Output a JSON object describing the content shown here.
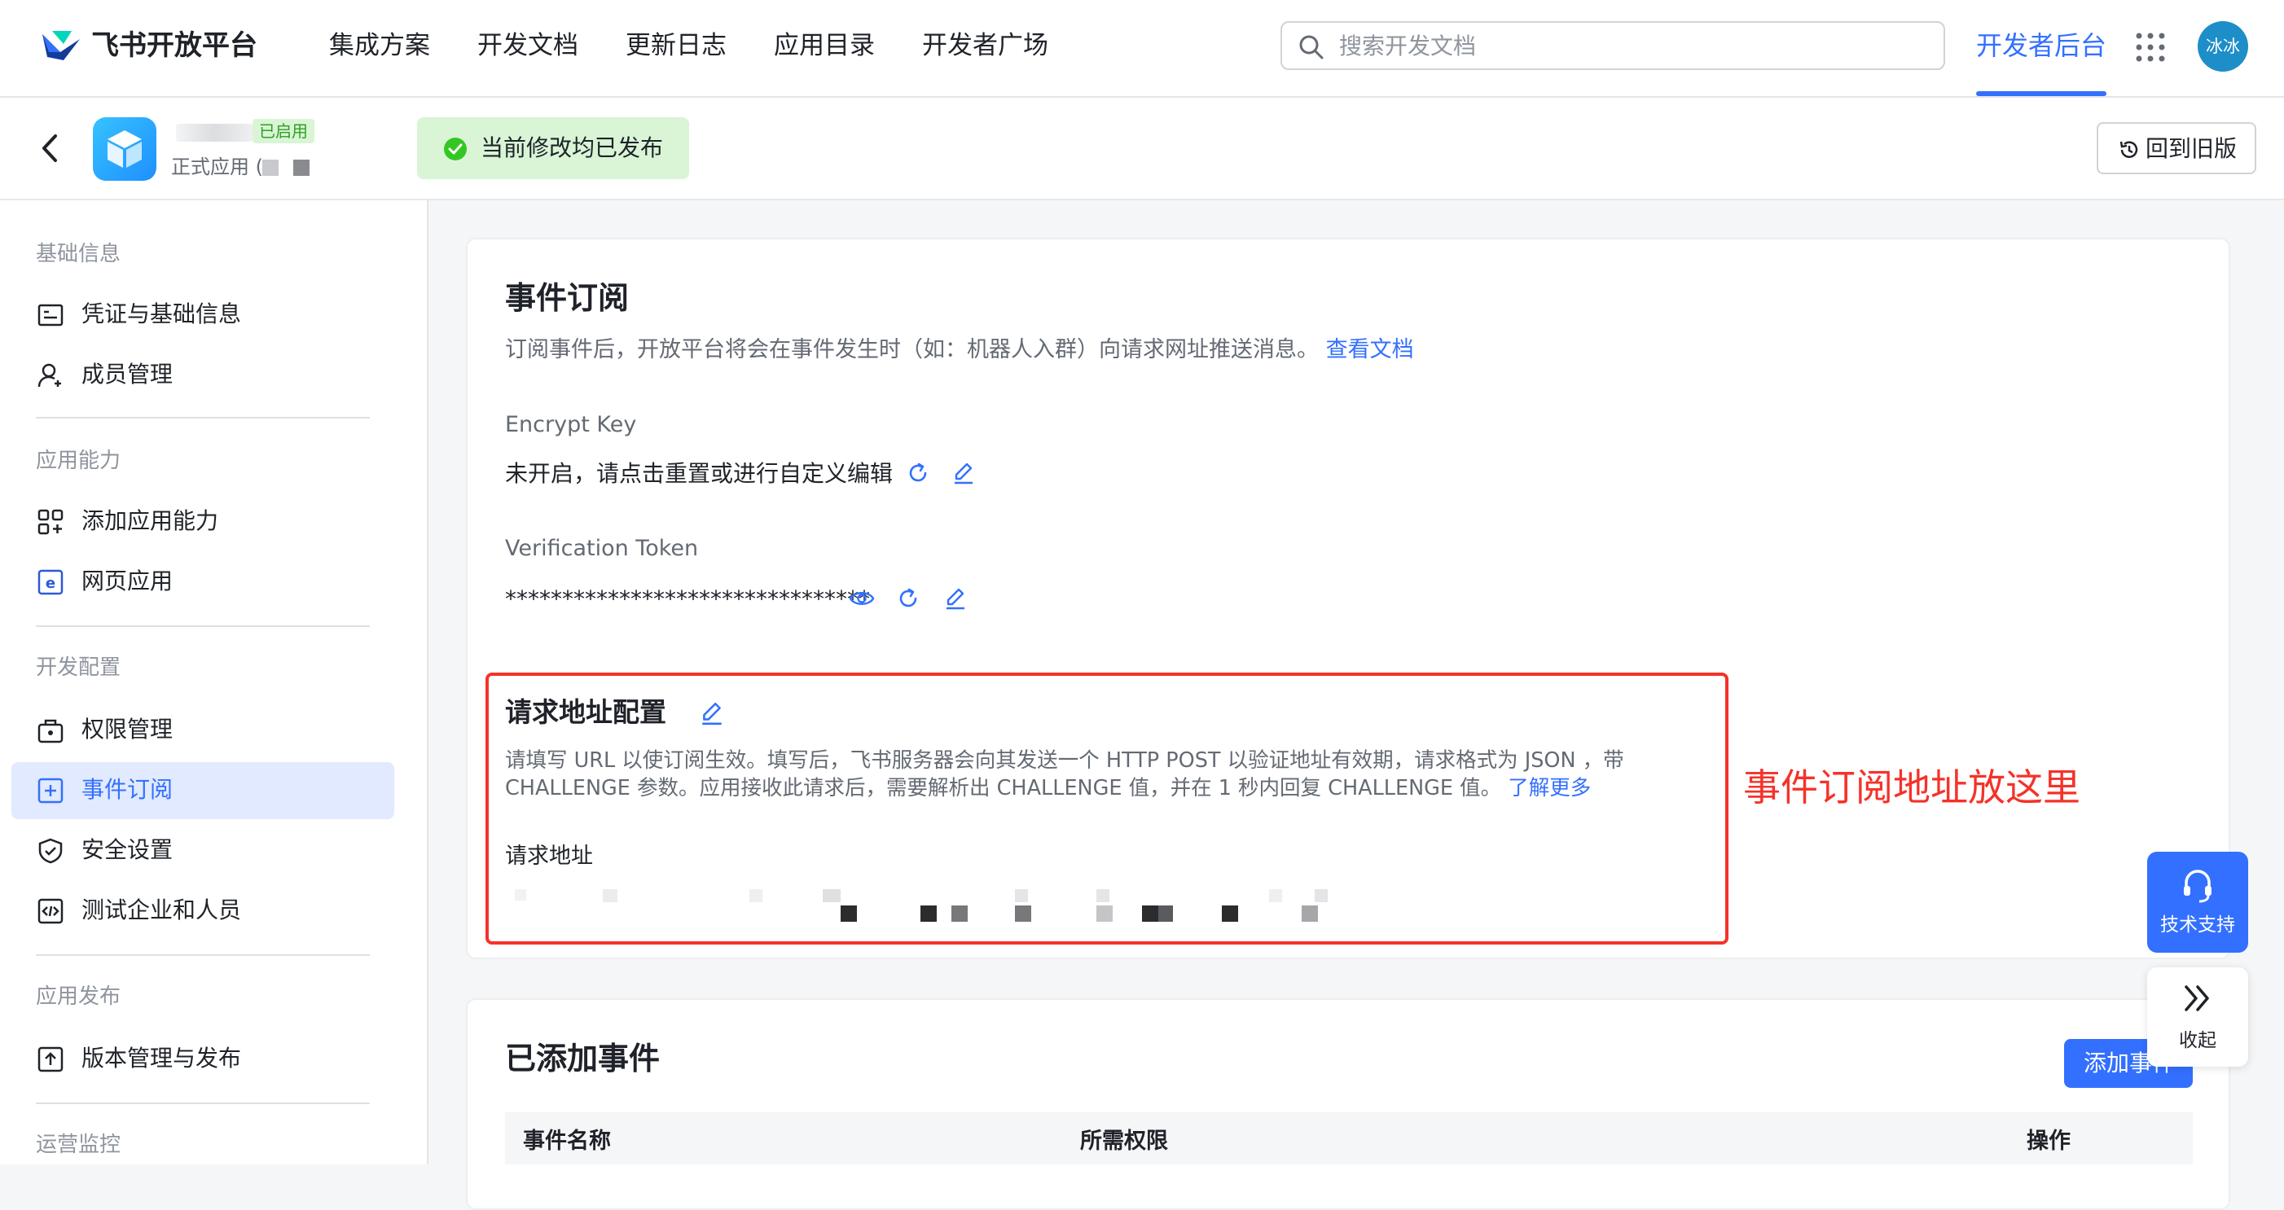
{
  "brand": {
    "name": "飞书开放平台"
  },
  "topnav": {
    "links": [
      "集成方案",
      "开发文档",
      "更新日志",
      "应用目录",
      "开发者广场"
    ],
    "search_placeholder": "搜索开发文档",
    "dev_console": "开发者后台",
    "avatar_text": "冰冰"
  },
  "app_header": {
    "status_tag": "已启用",
    "app_type": "正式应用 (",
    "publish_status": "当前修改均已发布",
    "back_to_old": "回到旧版"
  },
  "sidebar": {
    "groups": [
      {
        "title": "基础信息",
        "items": [
          {
            "label": "凭证与基础信息",
            "icon": "credential-icon"
          },
          {
            "label": "成员管理",
            "icon": "member-icon"
          }
        ]
      },
      {
        "title": "应用能力",
        "items": [
          {
            "label": "添加应用能力",
            "icon": "add-capability-icon"
          },
          {
            "label": "网页应用",
            "icon": "web-app-icon"
          }
        ]
      },
      {
        "title": "开发配置",
        "items": [
          {
            "label": "权限管理",
            "icon": "permission-icon"
          },
          {
            "label": "事件订阅",
            "icon": "event-icon",
            "active": true
          },
          {
            "label": "安全设置",
            "icon": "shield-icon"
          },
          {
            "label": "测试企业和人员",
            "icon": "test-icon"
          }
        ]
      },
      {
        "title": "应用发布",
        "items": [
          {
            "label": "版本管理与发布",
            "icon": "version-icon"
          }
        ]
      },
      {
        "title": "运营监控",
        "items": []
      }
    ]
  },
  "event_subscription": {
    "title": "事件订阅",
    "description": "订阅事件后，开放平台将会在事件发生时（如：机器人入群）向请求网址推送消息。",
    "doc_link": "查看文档",
    "encrypt_key": {
      "label": "Encrypt Key",
      "value": "未开启，请点击重置或进行自定义编辑"
    },
    "verification_token": {
      "label": "Verification Token",
      "value": "********************************"
    },
    "request_config": {
      "title": "请求地址配置",
      "desc_line1": "请填写 URL 以使订阅生效。填写后，飞书服务器会向其发送一个 HTTP POST 以验证地址有效期，请求格式为 JSON ，带",
      "desc_line2": "CHALLENGE 参数。应用接收此请求后，需要解析出 CHALLENGE 值，并在 1 秒内回复 CHALLENGE 值。",
      "learn_more": "了解更多",
      "url_label": "请求地址"
    }
  },
  "annotation": "事件订阅地址放这里",
  "added_events": {
    "title": "已添加事件",
    "add_button": "添加事件",
    "columns": [
      "事件名称",
      "所需权限",
      "操作"
    ]
  },
  "float": {
    "support": "技术支持",
    "collapse": "收起"
  },
  "colors": {
    "primary": "#3370ff",
    "annotation_red": "#f53229",
    "success_bg": "#d9f5d6",
    "success": "#2ea121"
  }
}
